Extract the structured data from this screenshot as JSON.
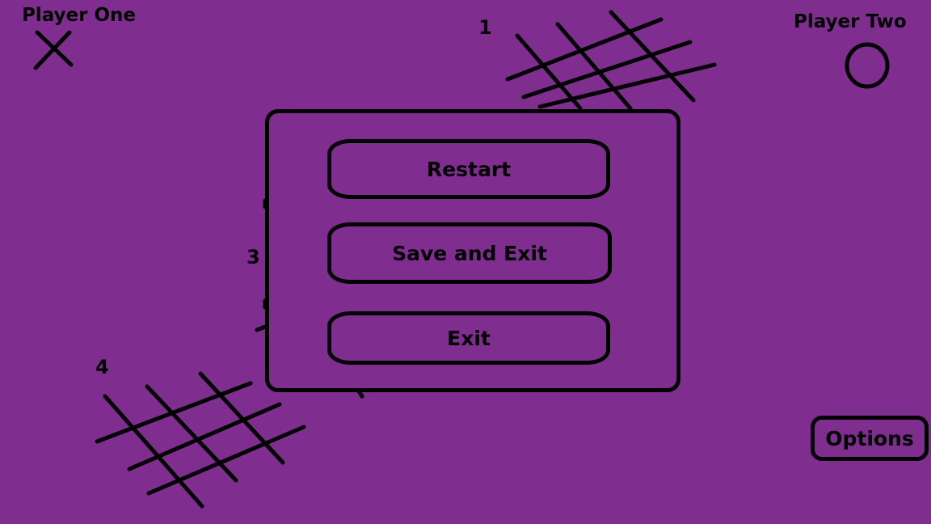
{
  "players": {
    "one": {
      "name": "Player One",
      "mark": "x-mark-icon"
    },
    "two": {
      "name": "Player Two",
      "mark": "o-mark-icon"
    }
  },
  "boards": [
    {
      "number": "1"
    },
    {
      "number": "3"
    },
    {
      "number": "4"
    }
  ],
  "menu": {
    "restart_label": "Restart",
    "save_exit_label": "Save and Exit",
    "exit_label": "Exit"
  },
  "options_label": "Options",
  "colors": {
    "background": "#7f2d8f",
    "ink": "#000000"
  }
}
